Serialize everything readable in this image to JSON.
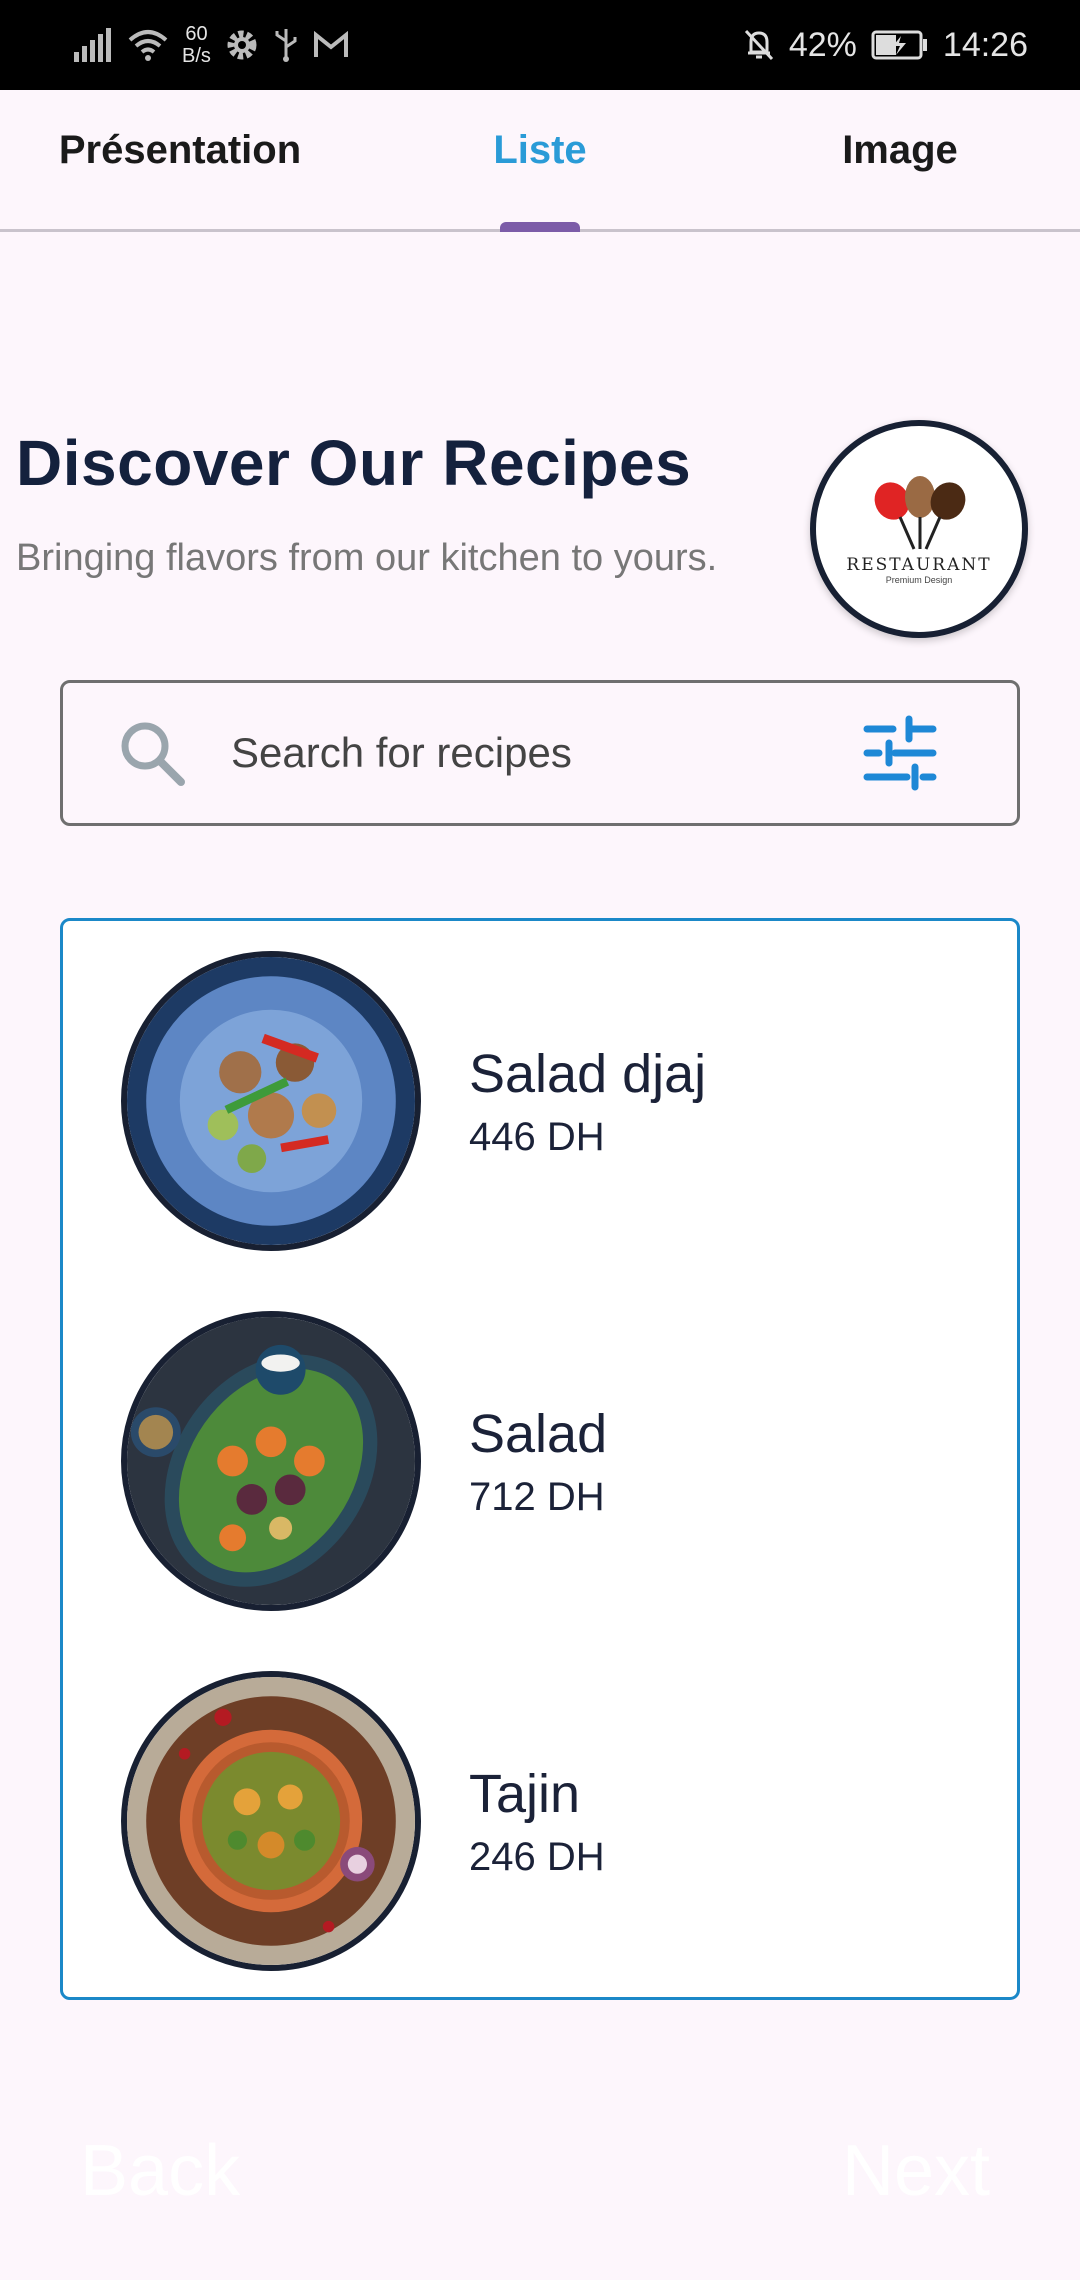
{
  "status_bar": {
    "net_speed_value": "60",
    "net_speed_unit": "B/s",
    "battery": "42%",
    "time": "14:26"
  },
  "tabs": [
    {
      "label": "Présentation",
      "active": false
    },
    {
      "label": "Liste",
      "active": true
    },
    {
      "label": "Image",
      "active": false
    }
  ],
  "header": {
    "title": "Discover Our Recipes",
    "subtitle": "Bringing flavors from our kitchen to yours.",
    "logo_text": "RESTAURANT",
    "logo_subtext": "Premium Design"
  },
  "search": {
    "placeholder": "Search for recipes",
    "value": ""
  },
  "recipes": [
    {
      "name": "Salad djaj",
      "price": "446 DH"
    },
    {
      "name": "Salad",
      "price": "712 DH"
    },
    {
      "name": "Tajin",
      "price": "246 DH"
    }
  ],
  "nav": {
    "back_label": "Back",
    "next_label": "Next"
  },
  "colors": {
    "accent": "#2a9bd7",
    "tab_indicator": "#7c5ca8",
    "list_border": "#1b88c8",
    "title": "#14213d"
  }
}
